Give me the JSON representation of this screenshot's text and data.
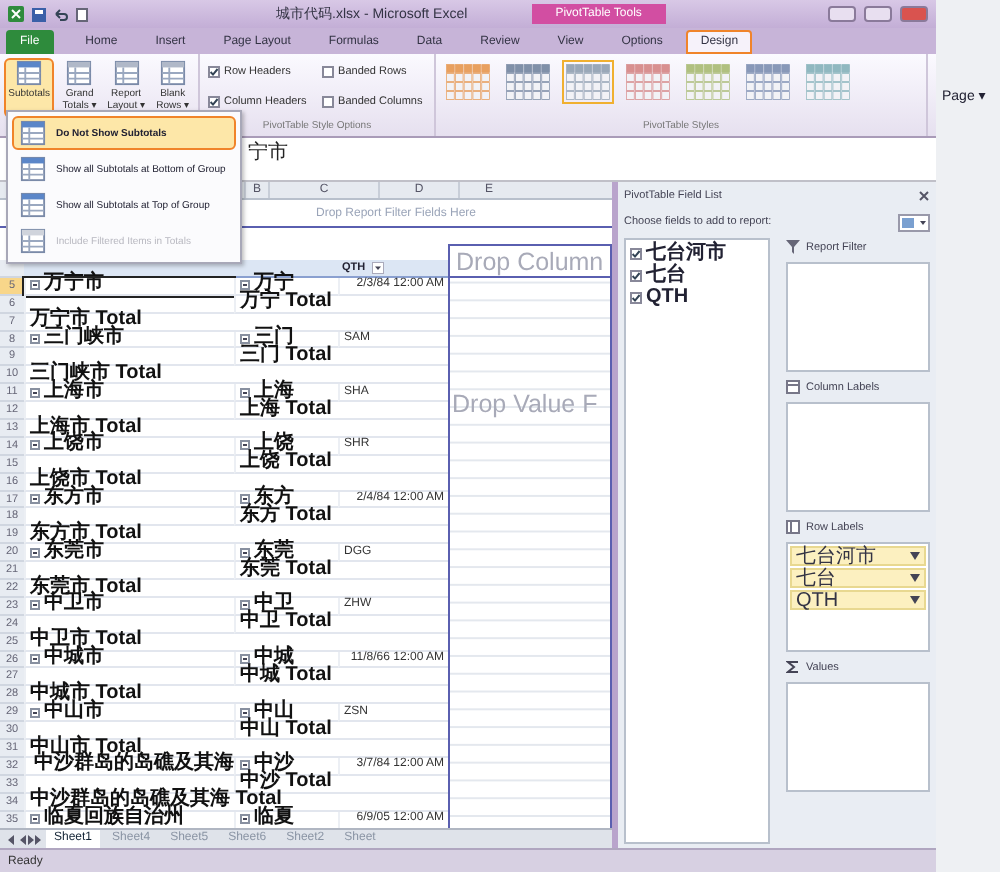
{
  "window": {
    "title": "城市代码.xlsx - Microsoft Excel",
    "context_tab": "PivotTable Tools"
  },
  "tabs": [
    {
      "label": "File",
      "kind": "file",
      "selected": false
    },
    {
      "label": "Home",
      "kind": "tab",
      "selected": false
    },
    {
      "label": "Insert",
      "kind": "tab",
      "selected": false
    },
    {
      "label": "Page Layout",
      "kind": "tab",
      "selected": false
    },
    {
      "label": "Formulas",
      "kind": "tab",
      "selected": false
    },
    {
      "label": "Data",
      "kind": "tab",
      "selected": false
    },
    {
      "label": "Review",
      "kind": "tab",
      "selected": false
    },
    {
      "label": "View",
      "kind": "tab",
      "selected": false
    },
    {
      "label": "Options",
      "kind": "tab",
      "selected": false
    },
    {
      "label": "Design",
      "kind": "tab",
      "selected": true
    }
  ],
  "ribbon": {
    "layout_buttons": [
      {
        "label": "Subtotals",
        "selected": true
      },
      {
        "label": "Grand Totals ▾",
        "selected": false
      },
      {
        "label": "Report Layout ▾",
        "selected": false
      },
      {
        "label": "Blank Rows ▾",
        "selected": false
      }
    ],
    "options": [
      {
        "label": "Row Headers",
        "checked": true
      },
      {
        "label": "Banded Rows",
        "checked": false
      },
      {
        "label": "Column Headers",
        "checked": true
      },
      {
        "label": "Banded Columns",
        "checked": false
      }
    ],
    "options_group": "PivotTable Style Options",
    "styles_group": "PivotTable Styles",
    "styles": [
      {
        "color": "#e8a060",
        "selected": false
      },
      {
        "color": "#8090a8",
        "selected": false
      },
      {
        "color": "#9aa8b8",
        "selected": true
      },
      {
        "color": "#d89090",
        "selected": false
      },
      {
        "color": "#b0c080",
        "selected": false
      },
      {
        "color": "#8898b8",
        "selected": false
      },
      {
        "color": "#90b8c0",
        "selected": false
      }
    ]
  },
  "subtotals_menu": [
    {
      "label": "Do Not Show Subtotals",
      "selected": true,
      "disabled": false
    },
    {
      "label": "Show all Subtotals at Bottom of Group",
      "selected": false,
      "disabled": false
    },
    {
      "label": "Show all Subtotals at Top of Group",
      "selected": false,
      "disabled": false
    },
    {
      "label": "Include Filtered Items in Totals",
      "selected": false,
      "disabled": true
    }
  ],
  "formula_bar": {
    "value": "宁市"
  },
  "columns": [
    "B",
    "C",
    "D",
    "E"
  ],
  "report_filter_drop": "Drop Report Filter Fields Here",
  "header_row": {
    "column_c": "QTH"
  },
  "rows": [
    {
      "number": "5",
      "kind": "group",
      "city": "万宁市",
      "county": "万宁",
      "code": "2/3/84 12:00 AM",
      "numeric": true,
      "selected": true
    },
    {
      "number": "6",
      "kind": "item-total",
      "label": "万宁 Total"
    },
    {
      "number": "7",
      "kind": "group-total",
      "label": "万宁市 Total"
    },
    {
      "number": "8",
      "kind": "group",
      "city": "三门峡市",
      "county": "三门",
      "code": "SAM",
      "numeric": false,
      "selected": false
    },
    {
      "number": "9",
      "kind": "item-total",
      "label": "三门 Total"
    },
    {
      "number": "10",
      "kind": "group-total",
      "label": "三门峡市 Total"
    },
    {
      "number": "11",
      "kind": "group",
      "city": "上海市",
      "county": "上海",
      "code": "SHA",
      "numeric": false,
      "selected": false
    },
    {
      "number": "12",
      "kind": "item-total",
      "label": "上海 Total"
    },
    {
      "number": "13",
      "kind": "group-total",
      "label": "上海市 Total"
    },
    {
      "number": "14",
      "kind": "group",
      "city": "上饶市",
      "county": "上饶",
      "code": "SHR",
      "numeric": false,
      "selected": false
    },
    {
      "number": "15",
      "kind": "item-total",
      "label": "上饶 Total"
    },
    {
      "number": "16",
      "kind": "group-total",
      "label": "上饶市 Total"
    },
    {
      "number": "17",
      "kind": "group",
      "city": "东方市",
      "county": "东方",
      "code": "2/4/84 12:00 AM",
      "numeric": true,
      "selected": false
    },
    {
      "number": "18",
      "kind": "item-total",
      "label": "东方 Total"
    },
    {
      "number": "19",
      "kind": "group-total",
      "label": "东方市 Total"
    },
    {
      "number": "20",
      "kind": "group",
      "city": "东莞市",
      "county": "东莞",
      "code": "DGG",
      "numeric": false,
      "selected": false
    },
    {
      "number": "21",
      "kind": "item-total",
      "label": "东莞 Total"
    },
    {
      "number": "22",
      "kind": "group-total",
      "label": "东莞市 Total"
    },
    {
      "number": "23",
      "kind": "group",
      "city": "中卫市",
      "county": "中卫",
      "code": "ZHW",
      "numeric": false,
      "selected": false
    },
    {
      "number": "24",
      "kind": "item-total",
      "label": "中卫 Total"
    },
    {
      "number": "25",
      "kind": "group-total",
      "label": "中卫市 Total"
    },
    {
      "number": "26",
      "kind": "group",
      "city": "中城市",
      "county": "中城",
      "code": "11/8/66 12:00 AM",
      "numeric": true,
      "selected": false
    },
    {
      "number": "27",
      "kind": "item-total",
      "label": "中城 Total"
    },
    {
      "number": "28",
      "kind": "group-total",
      "label": "中城市 Total"
    },
    {
      "number": "29",
      "kind": "group",
      "city": "中山市",
      "county": "中山",
      "code": "ZSN",
      "numeric": false,
      "selected": false
    },
    {
      "number": "30",
      "kind": "item-total",
      "label": "中山 Total"
    },
    {
      "number": "31",
      "kind": "group-total",
      "label": "中山市 Total"
    },
    {
      "number": "32",
      "kind": "group",
      "city": "中沙群岛的岛礁及其海",
      "county": "中沙",
      "code": "3/7/84 12:00 AM",
      "numeric": true,
      "selected": false
    },
    {
      "number": "33",
      "kind": "item-total",
      "label": "中沙 Total"
    },
    {
      "number": "34",
      "kind": "group-total",
      "label": "中沙群岛的岛礁及其海 Total"
    },
    {
      "number": "35",
      "kind": "group",
      "city": "临夏回族自治州",
      "county": "临夏",
      "code": "6/9/05 12:00 AM",
      "numeric": true,
      "selected": false
    }
  ],
  "drop_zone": {
    "column": "Drop Column",
    "value": "Drop Value F"
  },
  "sheet_tabs": [
    {
      "label": "Sheet1",
      "selected": true
    },
    {
      "label": "Sheet4",
      "selected": false
    },
    {
      "label": "Sheet5",
      "selected": false
    },
    {
      "label": "Sheet6",
      "selected": false
    },
    {
      "label": "Sheet2",
      "selected": false
    },
    {
      "label": "Sheet",
      "selected": false
    }
  ],
  "status_bar": "Ready",
  "field_list": {
    "title": "PivotTable Field List",
    "prompt": "Choose fields to add to report:",
    "fields": [
      {
        "label": "七台河市",
        "checked": true
      },
      {
        "label": "七台",
        "checked": true
      },
      {
        "label": "QTH",
        "checked": true
      }
    ],
    "areas": [
      {
        "label": "Report Filter",
        "kind": "filter"
      },
      {
        "label": "Column Labels",
        "kind": "columns"
      },
      {
        "label": "Row Labels",
        "kind": "rows",
        "items": [
          "七台河市",
          "七台",
          "QTH"
        ]
      },
      {
        "label": "Values",
        "kind": "values"
      }
    ]
  },
  "browser": {
    "menu": "Page ▾"
  }
}
